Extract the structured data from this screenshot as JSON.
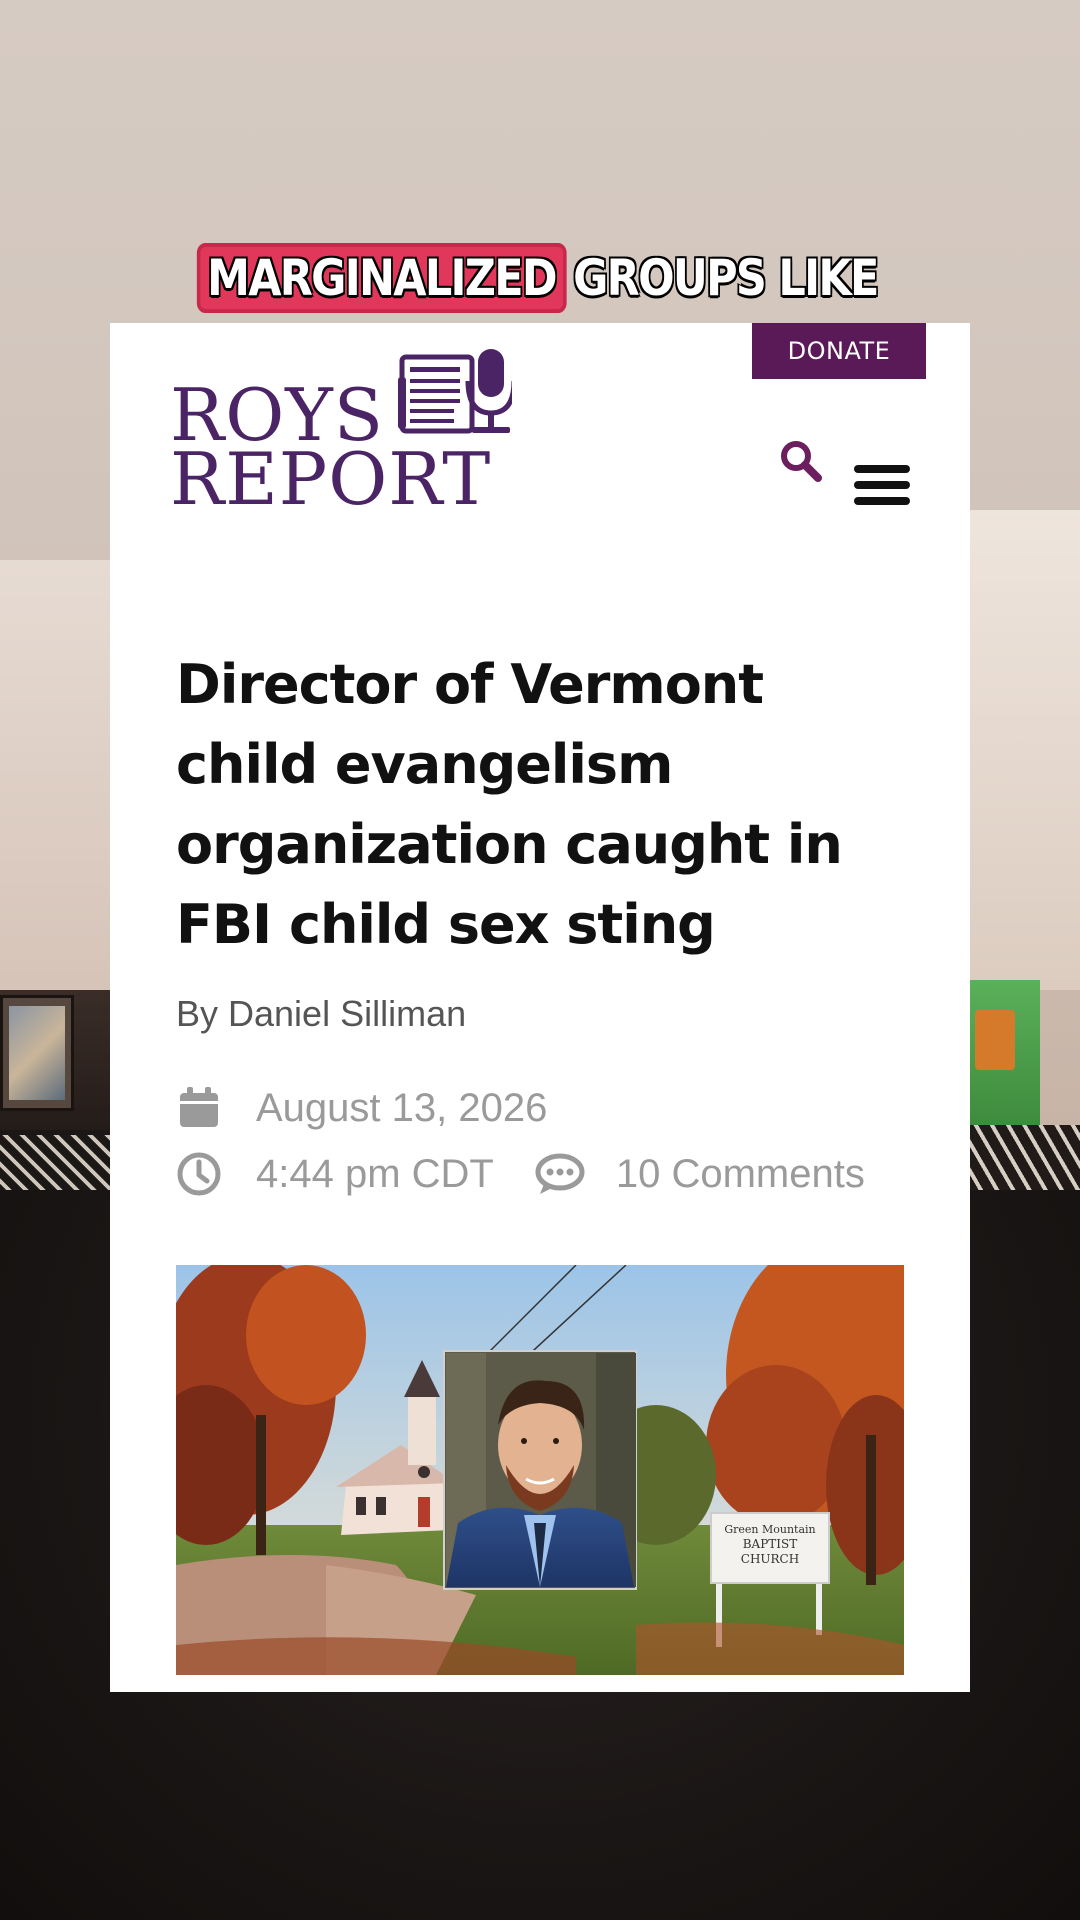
{
  "caption": {
    "highlight": "MARGINALIZED",
    "rest": "GROUPS LIKE"
  },
  "site": {
    "logo_line1": "ROYS",
    "logo_line2": "REPORT",
    "donate_label": "DONATE",
    "brand_color": "#4b2466",
    "donate_color": "#5a1a58"
  },
  "header_icons": {
    "search": "search-icon",
    "menu": "hamburger-menu-icon"
  },
  "article": {
    "title": "Director of Vermont child evangelism organization caught in FBI child sex sting",
    "byline": "By Daniel Silliman",
    "date": "August 13, 2026",
    "time": "4:44 pm CDT",
    "comments": "10 Comments",
    "image_sign": {
      "line1": "Green Mountain",
      "line2": "BAPTIST",
      "line3": "CHURCH"
    }
  }
}
